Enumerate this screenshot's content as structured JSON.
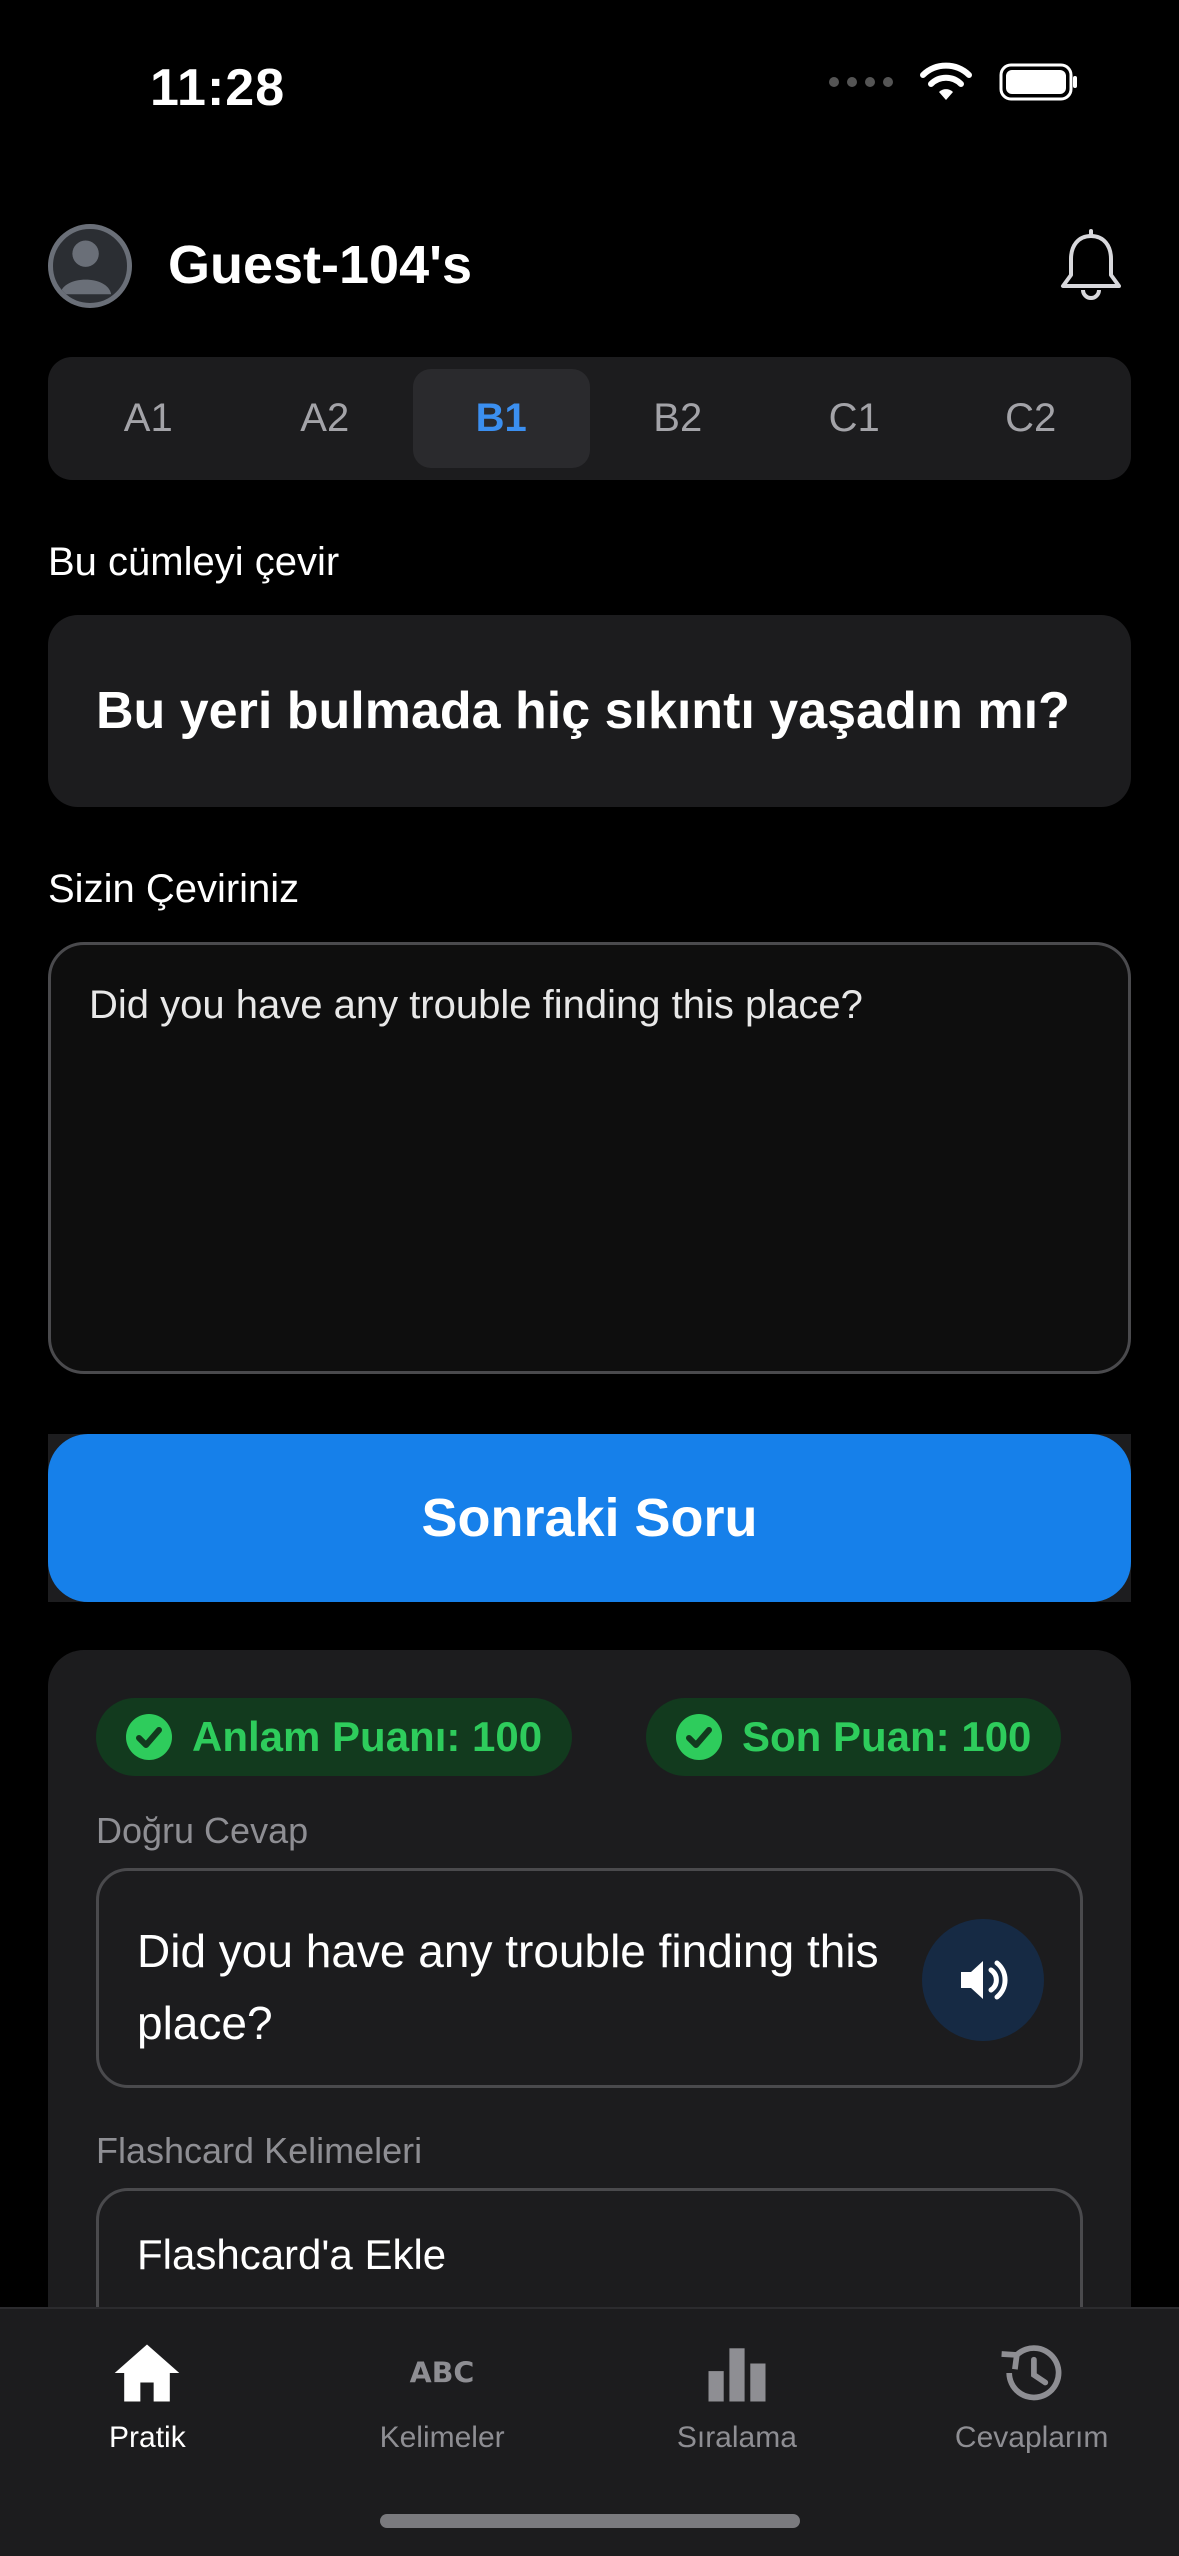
{
  "status_bar": {
    "time": "11:28"
  },
  "header": {
    "title": "Guest-104's"
  },
  "levels": [
    {
      "label": "A1",
      "active": false
    },
    {
      "label": "A2",
      "active": false
    },
    {
      "label": "B1",
      "active": true
    },
    {
      "label": "B2",
      "active": false
    },
    {
      "label": "C1",
      "active": false
    },
    {
      "label": "C2",
      "active": false
    }
  ],
  "prompt": {
    "label": "Bu cümleyi çevir",
    "sentence": "Bu yeri bulmada hiç sıkıntı yaşadın mı?"
  },
  "translation": {
    "label": "Sizin Çeviriniz",
    "value": "Did you have any trouble finding this place?"
  },
  "next_button": {
    "label": "Sonraki Soru"
  },
  "result": {
    "meaning_score": "Anlam Puanı: 100",
    "final_score": "Son Puan: 100",
    "correct_label": "Doğru Cevap",
    "correct_answer": "Did you have any trouble finding this place?",
    "flashcard_label": "Flashcard Kelimeleri",
    "flashcard_add": "Flashcard'a Ekle"
  },
  "tabs": [
    {
      "label": "Pratik",
      "icon": "home-icon",
      "active": true
    },
    {
      "label": "Kelimeler",
      "icon": "abc-icon",
      "active": false
    },
    {
      "label": "Sıralama",
      "icon": "bar-chart-icon",
      "active": false
    },
    {
      "label": "Cevaplarım",
      "icon": "history-icon",
      "active": false
    }
  ],
  "colors": {
    "accent": "#1680ea",
    "active_level": "#3b8ff0",
    "success": "#2ecc5c"
  }
}
